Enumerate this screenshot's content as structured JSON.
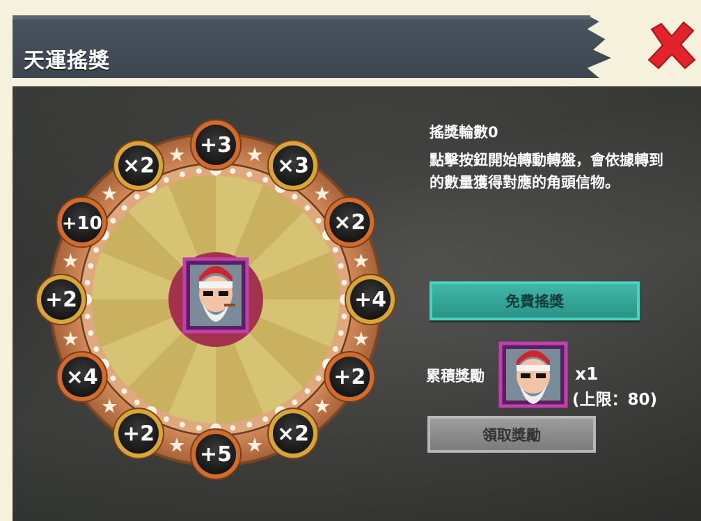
{
  "header": {
    "title": "天運搖獎"
  },
  "info": {
    "rounds_label": "搖獎輪數0",
    "description": "點擊按鈕開始轉動轉盤，會依據轉到的數量獲得對應的角頭信物。"
  },
  "buttons": {
    "spin_label": "免費搖獎",
    "claim_label": "領取獎勵"
  },
  "reward": {
    "label": "累積獎勵",
    "count": "x1",
    "limit": "(上限：80)"
  },
  "wheel": {
    "slots": [
      "+3",
      "×3",
      "×2",
      "+4",
      "+2",
      "×2",
      "+5",
      "+2",
      "×4",
      "+2",
      "+10",
      "×2"
    ]
  },
  "colors": {
    "accent_teal": "#3fb7a7",
    "wheel_ring": "#c8845a",
    "close_red": "#e2232a"
  }
}
